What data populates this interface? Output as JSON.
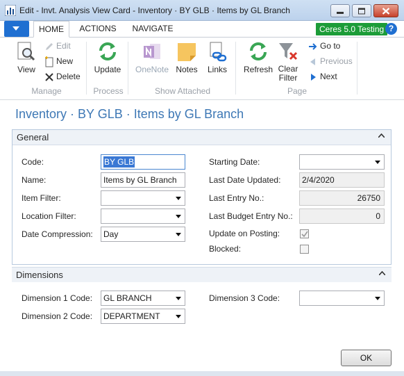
{
  "window": {
    "title": "Edit - Invt. Analysis View Card - Inventory · BY GLB · Items by GL Branch"
  },
  "ribbon_tabs": {
    "home": "HOME",
    "actions": "ACTIONS",
    "navigate": "NAVIGATE"
  },
  "badge": {
    "text": "Ceres 5.0 Testing",
    "color": "#1c9c38"
  },
  "help": {
    "glyph": "?"
  },
  "ribbon": {
    "manage": {
      "label": "Manage",
      "view": "View",
      "edit": "Edit",
      "new": "New",
      "delete": "Delete"
    },
    "process": {
      "label": "Process",
      "update": "Update"
    },
    "show_attached": {
      "label": "Show Attached",
      "onenote": "OneNote",
      "notes": "Notes",
      "links": "Links"
    },
    "page": {
      "label": "Page",
      "refresh": "Refresh",
      "clear_filter": "Clear Filter",
      "goto": "Go to",
      "previous": "Previous",
      "next": "Next"
    }
  },
  "page_title": "Inventory · BY GLB · Items by GL Branch",
  "general": {
    "title": "General",
    "code_label": "Code:",
    "code_value": "BY GLB",
    "name_label": "Name:",
    "name_value": "Items by GL Branch",
    "item_filter_label": "Item Filter:",
    "item_filter_value": "",
    "location_filter_label": "Location Filter:",
    "location_filter_value": "",
    "date_compression_label": "Date Compression:",
    "date_compression_value": "Day",
    "starting_date_label": "Starting Date:",
    "starting_date_value": "",
    "last_date_updated_label": "Last Date Updated:",
    "last_date_updated_value": "2/4/2020",
    "last_entry_no_label": "Last Entry No.:",
    "last_entry_no_value": "26750",
    "last_budget_entry_no_label": "Last Budget Entry No.:",
    "last_budget_entry_no_value": "0",
    "update_on_posting_label": "Update on Posting:",
    "update_on_posting_checked": true,
    "blocked_label": "Blocked:",
    "blocked_checked": false
  },
  "dimensions": {
    "title": "Dimensions",
    "dim1_label": "Dimension 1 Code:",
    "dim1_value": "GL BRANCH",
    "dim2_label": "Dimension 2 Code:",
    "dim2_value": "DEPARTMENT",
    "dim3_label": "Dimension 3 Code:",
    "dim3_value": ""
  },
  "ok_label": "OK",
  "icons": {
    "app": "dynamics-nav-icon",
    "minimize": "minimize-icon",
    "maximize": "maximize-icon",
    "close": "close-icon",
    "view": "view-magnifier-icon",
    "edit": "pencil-icon",
    "new": "new-document-icon",
    "delete": "delete-x-icon",
    "update": "refresh-icon",
    "onenote": "onenote-icon",
    "notes": "note-icon",
    "links": "link-icon",
    "refresh": "refresh-icon",
    "clear_filter": "clear-filter-icon",
    "goto": "arrow-right-icon",
    "previous": "triangle-left-icon",
    "next": "triangle-right-icon"
  }
}
